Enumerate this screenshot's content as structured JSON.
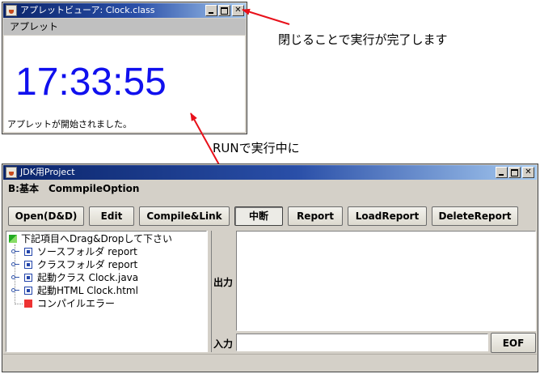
{
  "applet_viewer": {
    "title": "アプレットビューア: Clock.class",
    "menu": [
      "アプレット"
    ],
    "clock_time": "17:33:55",
    "status": "アプレットが開始されました。"
  },
  "annotations": {
    "close_note": "閉じることで実行が完了します",
    "run_note": "RUNで実行中に"
  },
  "jdk_window": {
    "title": "JDK用Project",
    "menu": [
      "B:基本",
      "CommpileOption"
    ],
    "buttons": {
      "open": "Open(D&D)",
      "edit": "Edit",
      "compile": "Compile&Link",
      "stop": "中断",
      "report": "Report",
      "load_report": "LoadReport",
      "delete_report": "DeleteReport",
      "eof": "EOF"
    },
    "tree": {
      "root": "下記項目へDrag&Dropして下さい",
      "items": [
        {
          "label": "ソースフォルダ   report"
        },
        {
          "label": "クラスフォルダ   report"
        },
        {
          "label": "起動クラス   Clock.java"
        },
        {
          "label": "起動HTML   Clock.html"
        }
      ],
      "error": "コンパイルエラー"
    },
    "labels": {
      "output": "出力",
      "input": "入力"
    }
  },
  "colors": {
    "title_active": "#0a246a",
    "clock_digits": "#1010ee",
    "arrow": "#e8101a"
  }
}
